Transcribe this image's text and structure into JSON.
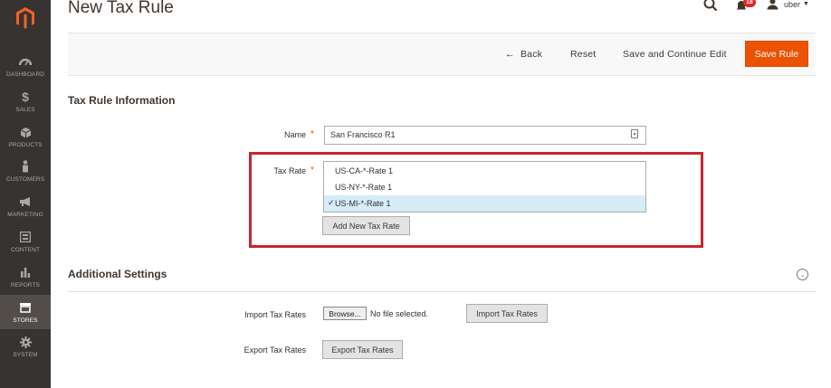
{
  "header": {
    "title": "New Tax Rule",
    "notification_count": "18",
    "user_name": "uber"
  },
  "sidebar": {
    "items": [
      {
        "label": "DASHBOARD",
        "icon": "dashboard-icon"
      },
      {
        "label": "SALES",
        "icon": "dollar-icon"
      },
      {
        "label": "PRODUCTS",
        "icon": "cube-icon"
      },
      {
        "label": "CUSTOMERS",
        "icon": "person-icon"
      },
      {
        "label": "MARKETING",
        "icon": "megaphone-icon"
      },
      {
        "label": "CONTENT",
        "icon": "layout-icon"
      },
      {
        "label": "REPORTS",
        "icon": "bar-chart-icon"
      },
      {
        "label": "STORES",
        "icon": "store-icon",
        "active": true
      },
      {
        "label": "SYSTEM",
        "icon": "gear-icon"
      }
    ]
  },
  "actions": {
    "back_label": "Back",
    "reset_label": "Reset",
    "save_continue_label": "Save and Continue Edit",
    "save_rule_label": "Save Rule"
  },
  "tax_rule_info": {
    "section_title": "Tax Rule Information",
    "name_label": "Name",
    "name_value": "San Francisco R1",
    "tax_rate_label": "Tax Rate",
    "tax_rates": [
      {
        "label": "US-CA-*-Rate 1",
        "selected": false
      },
      {
        "label": "US-NY-*-Rate 1",
        "selected": false
      },
      {
        "label": "US-MI-*-Rate 1",
        "selected": true
      }
    ],
    "add_rate_label": "Add New Tax Rate"
  },
  "additional_settings": {
    "section_title": "Additional Settings",
    "import_label": "Import Tax Rates",
    "browse_label": "Browse...",
    "no_file_text": "No file selected.",
    "import_button_label": "Import Tax Rates",
    "export_label": "Export Tax Rates",
    "export_button_label": "Export Tax Rates"
  },
  "colors": {
    "sidebar_bg": "#373330",
    "primary_button": "#eb5202",
    "highlight_border": "#c8252f",
    "selected_option": "#d6ecf7"
  }
}
